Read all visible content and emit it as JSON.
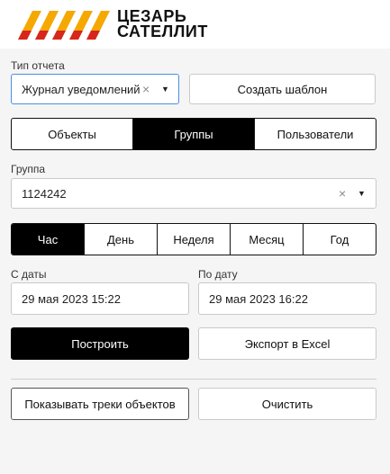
{
  "brand": {
    "line1": "ЦЕЗАРЬ",
    "line2": "САТЕЛЛИТ",
    "stripe_color": "#f5a800",
    "stripe_accent": "#d7261d"
  },
  "report_type": {
    "label": "Тип отчета",
    "value": "Журнал уведомлений",
    "clear_icon": "×",
    "caret_icon": "▼"
  },
  "create_template_label": "Создать шаблон",
  "entity_tabs": [
    {
      "label": "Объекты",
      "active": false
    },
    {
      "label": "Группы",
      "active": true
    },
    {
      "label": "Пользователи",
      "active": false
    }
  ],
  "group": {
    "label": "Группа",
    "value": "1124242",
    "clear_icon": "×",
    "caret_icon": "▼"
  },
  "period_tabs": [
    {
      "label": "Час",
      "active": true
    },
    {
      "label": "День",
      "active": false
    },
    {
      "label": "Неделя",
      "active": false
    },
    {
      "label": "Месяц",
      "active": false
    },
    {
      "label": "Год",
      "active": false
    }
  ],
  "date_from": {
    "label": "С даты",
    "value": "29 мая 2023 15:22"
  },
  "date_to": {
    "label": "По дату",
    "value": "29 мая 2023 16:22"
  },
  "actions": {
    "build_label": "Построить",
    "export_label": "Экспорт в Excel",
    "show_tracks_label": "Показывать треки объектов",
    "clear_label": "Очистить"
  }
}
